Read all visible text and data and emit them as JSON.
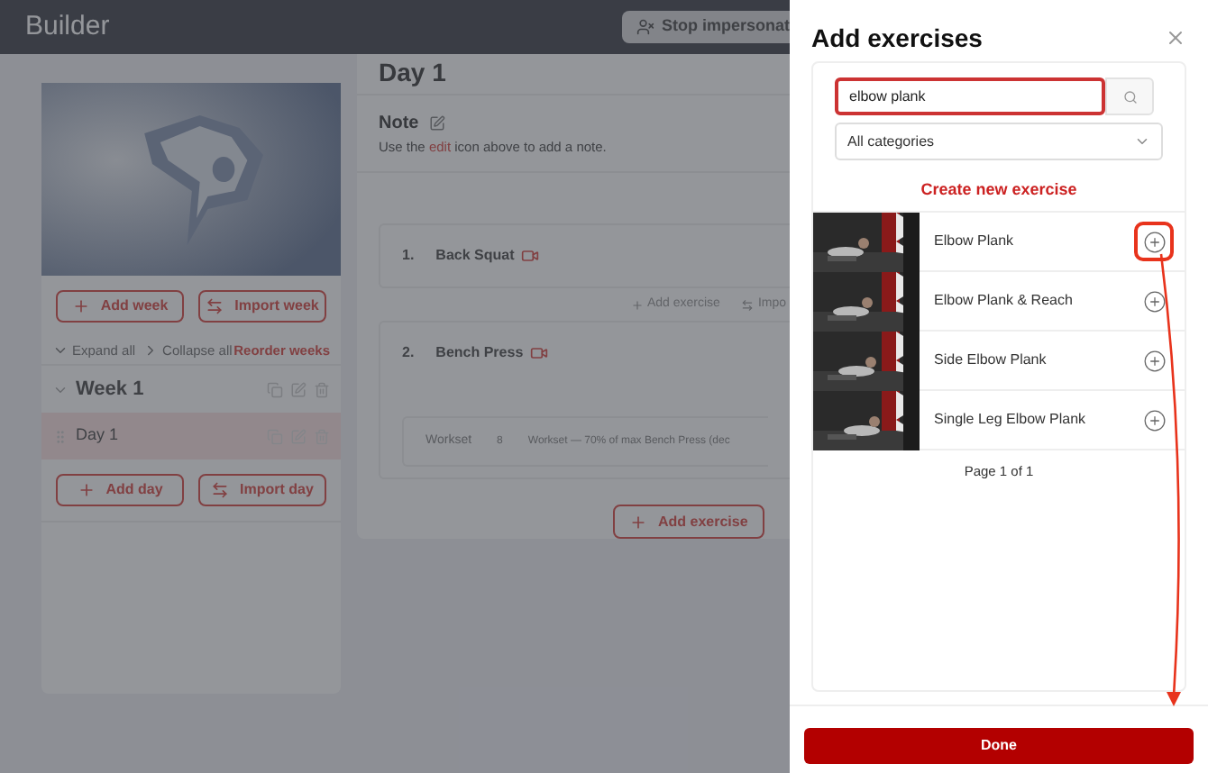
{
  "header": {
    "title": "Builder",
    "impersonate_button": "Stop impersonat"
  },
  "sidebar": {
    "add_week": "Add week",
    "import_week": "Import week",
    "expand_all": "Expand all",
    "collapse_all": "Collapse all",
    "reorder_weeks": "Reorder weeks",
    "weeks": [
      {
        "label": "Week 1",
        "expanded": true,
        "children": [
          {
            "label": "Day 1",
            "selected": true
          }
        ]
      }
    ],
    "add_day": "Add day",
    "import_day": "Import day"
  },
  "main": {
    "title": "Day 1",
    "note_title": "Note",
    "note_hint_before": "Use the",
    "note_hint_link": "edit",
    "note_hint_after": "icon above to add a note.",
    "exercises": [
      {
        "number": "1.",
        "name": "Back Squat"
      },
      {
        "number": "2.",
        "name": "Bench Press",
        "sets": [
          {
            "type": "Workset",
            "reps": "8",
            "description": "Workset — 70% of max Bench Press (dec"
          }
        ]
      }
    ],
    "between_add": "Add exercise",
    "between_import": "Impo",
    "add_exercise": "Add exercise"
  },
  "drawer": {
    "title": "Add exercises",
    "search": {
      "value": "elbow plank"
    },
    "category": "All categories",
    "create_link": "Create new exercise",
    "results": [
      {
        "name": "Elbow Plank",
        "highlighted": true
      },
      {
        "name": "Elbow Plank & Reach",
        "highlighted": false
      },
      {
        "name": "Side Elbow Plank",
        "highlighted": false
      },
      {
        "name": "Single Leg Elbow Plank",
        "highlighted": false
      }
    ],
    "pagination": "Page 1 of 1",
    "done": "Done"
  }
}
